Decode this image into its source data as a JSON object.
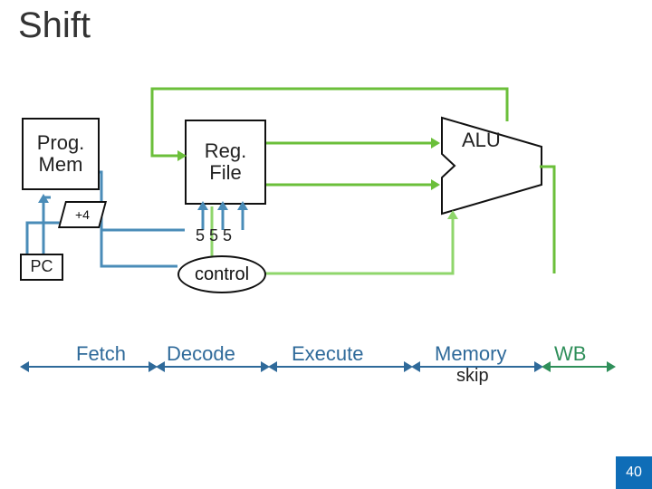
{
  "title": "Shift",
  "blocks": {
    "prog_mem": "Prog.\nMem",
    "reg_file": "Reg.\nFile",
    "alu": "ALU",
    "pc": "PC",
    "plus4": "+4",
    "control": "control"
  },
  "bits_label": "5 5 5",
  "stages": {
    "fetch": "Fetch",
    "decode": "Decode",
    "execute": "Execute",
    "memory": "Memory",
    "wb": "WB"
  },
  "skip_label": "skip",
  "page_number": "40",
  "colors": {
    "blue": "#2f6a9a",
    "blue_line": "#4a8cb8",
    "green": "#6bbf3a",
    "dark": "#111"
  },
  "chart_data": {
    "type": "diagram",
    "description": "CPU pipeline datapath for a Shift instruction",
    "blocks": [
      "Prog. Mem",
      "+4",
      "PC",
      "Reg. File",
      "control",
      "ALU"
    ],
    "stages": [
      "Fetch",
      "Decode",
      "Execute",
      "Memory",
      "WB"
    ],
    "memory_stage_action": "skip",
    "edges": [
      {
        "from": "PC",
        "to": "Prog. Mem",
        "color": "blue"
      },
      {
        "from": "Prog. Mem",
        "to": "Reg. File",
        "color": "blue",
        "label": "5 5 5"
      },
      {
        "from": "Prog. Mem",
        "to": "control",
        "color": "blue"
      },
      {
        "from": "+4",
        "to": "PC",
        "color": "blue"
      },
      {
        "from": "Reg. File",
        "to": "ALU",
        "color": "green",
        "operands": 2
      },
      {
        "from": "control",
        "to": "ALU",
        "color": "green"
      },
      {
        "from": "ALU",
        "to": "Reg. File",
        "color": "green",
        "note": "writeback"
      }
    ]
  }
}
